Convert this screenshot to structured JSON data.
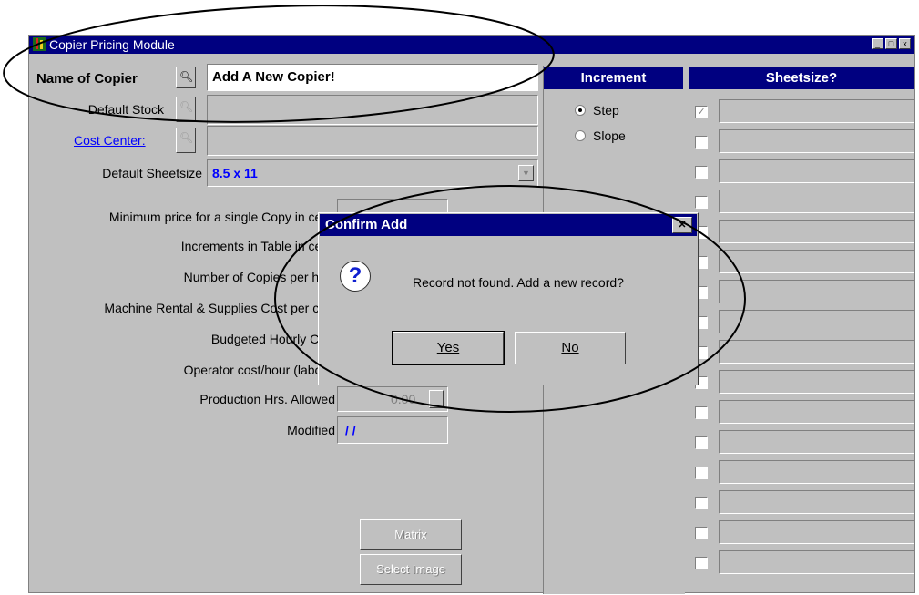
{
  "window": {
    "title": "Copier Pricing Module",
    "controls": [
      "_",
      "□",
      "x"
    ]
  },
  "form": {
    "name_of_copier_label": "Name of Copier",
    "name_of_copier_value": "Add A New Copier!",
    "default_stock_label": "Default Stock",
    "cost_center_label": "Cost Center:",
    "default_sheetsize_label": "Default Sheetsize",
    "default_sheetsize_value": "8.5 x 11",
    "min_price_label": "Minimum price for a single Copy in cer",
    "increments_label": "Increments in Table in cer",
    "copies_per_hour_label": "Number of Copies per ho",
    "machine_rental_label": "Machine Rental & Supplies Cost per co",
    "budgeted_label": "Budgeted Hourly Co",
    "operator_label": "Operator cost/hour (labor",
    "production_label": "Production Hrs. Allowed",
    "production_value": "0.00",
    "modified_label": "Modified",
    "modified_value": "/ /"
  },
  "increment": {
    "header": "Increment",
    "options": [
      {
        "label": "Step",
        "selected": true
      },
      {
        "label": "Slope",
        "selected": false
      }
    ]
  },
  "sheetsize": {
    "header": "Sheetsize?",
    "rows": [
      {
        "checked": true
      },
      {
        "checked": false
      },
      {
        "checked": false
      },
      {
        "checked": false
      },
      {
        "checked": false
      },
      {
        "checked": false
      },
      {
        "checked": false
      },
      {
        "checked": false
      },
      {
        "checked": false
      },
      {
        "checked": false
      },
      {
        "checked": false
      },
      {
        "checked": false
      },
      {
        "checked": false
      },
      {
        "checked": false
      },
      {
        "checked": false
      },
      {
        "checked": false
      }
    ]
  },
  "buttons": {
    "matrix": "Matrix",
    "select_image": "Select Image"
  },
  "dialog": {
    "title": "Confirm Add",
    "message": "Record not found. Add a new record?",
    "yes": "Yes",
    "no": "No"
  },
  "icons": {
    "lookup": "magnifier-icon",
    "question": "question-icon",
    "dropdown": "chevron-down-icon"
  },
  "colors": {
    "titlebar": "#000080",
    "face": "#c0c0c0",
    "link": "#0000ff"
  }
}
